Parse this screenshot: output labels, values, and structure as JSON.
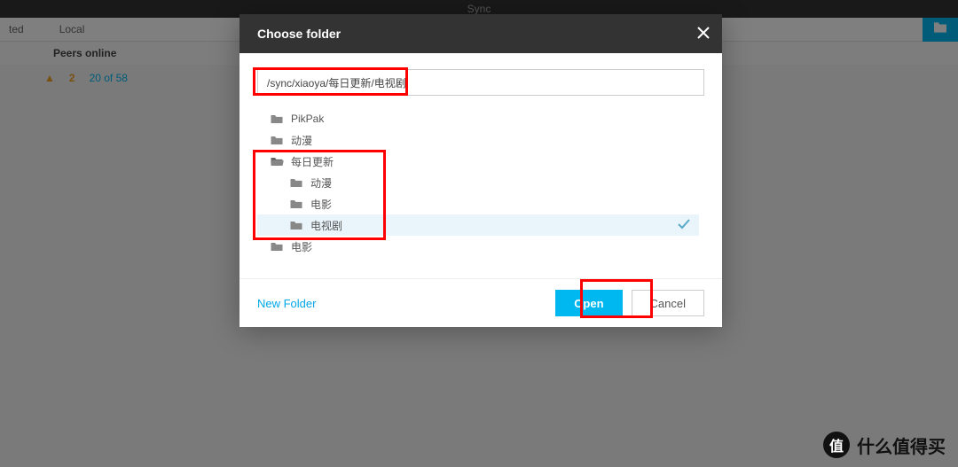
{
  "app": {
    "title": "Sync"
  },
  "bg": {
    "tabs": [
      "ted",
      "Local"
    ],
    "subhead": "Peers online",
    "warn_count": "2",
    "status": "20 of 58"
  },
  "modal": {
    "title": "Choose folder",
    "path": "/sync/xiaoya/每日更新/电视剧",
    "new_folder": "New Folder",
    "open": "Open",
    "cancel": "Cancel"
  },
  "tree": [
    {
      "label": "PikPak",
      "indent": 14,
      "open": false,
      "selected": false
    },
    {
      "label": "动漫",
      "indent": 14,
      "open": false,
      "selected": false
    },
    {
      "label": "每日更新",
      "indent": 14,
      "open": true,
      "selected": false
    },
    {
      "label": "动漫",
      "indent": 36,
      "open": false,
      "selected": false
    },
    {
      "label": "电影",
      "indent": 36,
      "open": false,
      "selected": false
    },
    {
      "label": "电视剧",
      "indent": 36,
      "open": false,
      "selected": true
    },
    {
      "label": "电影",
      "indent": 14,
      "open": false,
      "selected": false
    }
  ],
  "watermark": "什么值得买"
}
